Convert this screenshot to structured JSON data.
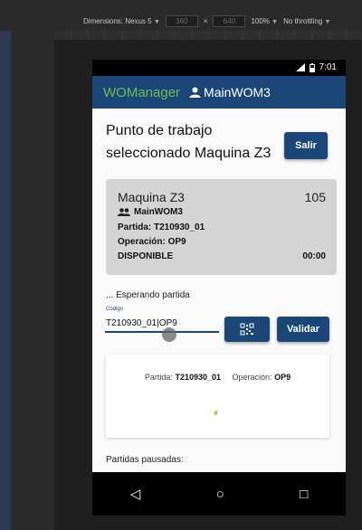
{
  "devtools": {
    "dimensions_label": "Dimensions: Nexus 5",
    "width": "360",
    "height": "640",
    "zoom": "100%",
    "throttle": "No throttling"
  },
  "statusbar": {
    "time": "7:01"
  },
  "header": {
    "brand": "WOManager",
    "user": "MainWOM3"
  },
  "page": {
    "title": "Punto de trabajo seleccionado Maquina Z3",
    "exit_label": "Salir"
  },
  "machine_card": {
    "machine": "Maquina Z3",
    "number": "105",
    "user": "MainWOM3",
    "partida": "Partida: T210930_01",
    "operacion": "Operación: OP9",
    "status": "DISPONIBLE",
    "time": "00:00"
  },
  "form": {
    "waiting_text": "... Esperando partida",
    "code_label": "Código",
    "code_value": "T210930_01|OP9",
    "validate_label": "Validar"
  },
  "result": {
    "partida_label": "Partida:",
    "partida_value": "T210930_01",
    "operacion_label": "Operación:",
    "operacion_value": "OP9"
  },
  "paused": {
    "label": "Partidas pausadas:"
  },
  "icons": {
    "qr": "qr-code-icon",
    "user": "user-icon",
    "group": "group-icon",
    "back": "back-icon",
    "home": "home-icon",
    "recents": "recents-icon"
  },
  "colors": {
    "primary": "#1b4778",
    "brand": "#6dbf4b"
  }
}
